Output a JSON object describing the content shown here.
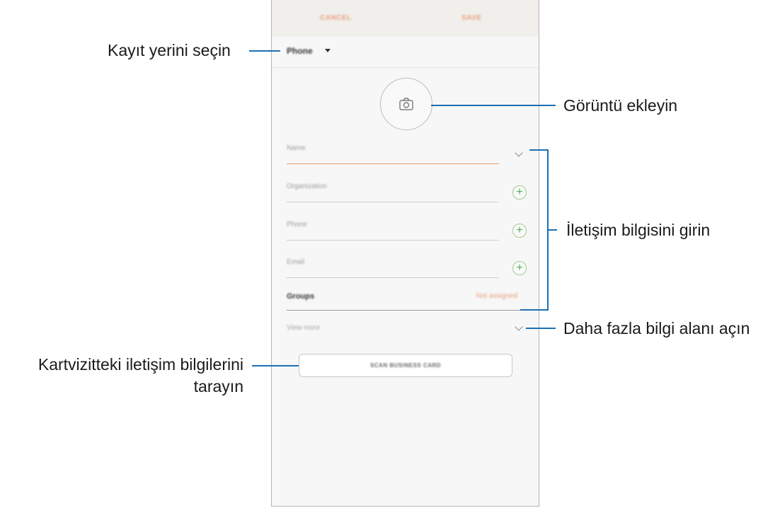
{
  "phone": {
    "topbar": {
      "cancel": "CANCEL",
      "save": "SAVE"
    },
    "storage": {
      "value": "Phone"
    },
    "fields": [
      {
        "placeholder": "Name"
      },
      {
        "placeholder": "Organization"
      },
      {
        "placeholder": "Phone"
      },
      {
        "placeholder": "Email"
      }
    ],
    "groups": {
      "label": "Groups",
      "value": "Not assigned"
    },
    "view_more": "View more",
    "scan_button": "SCAN BUSINESS CARD"
  },
  "annotations": {
    "storage": "Kayıt yerini seçin",
    "photo": "Görüntü ekleyin",
    "contact_info": "İletişim bilgisini girin",
    "more_fields": "Daha fazla bilgi alanı açın",
    "scan_line1": "Kartvizitteki iletişim bilgilerini",
    "scan_line2": "tarayın"
  },
  "colors": {
    "accent": "#e8a07a",
    "callout": "#1d6fb3",
    "plus": "#4caf50"
  }
}
